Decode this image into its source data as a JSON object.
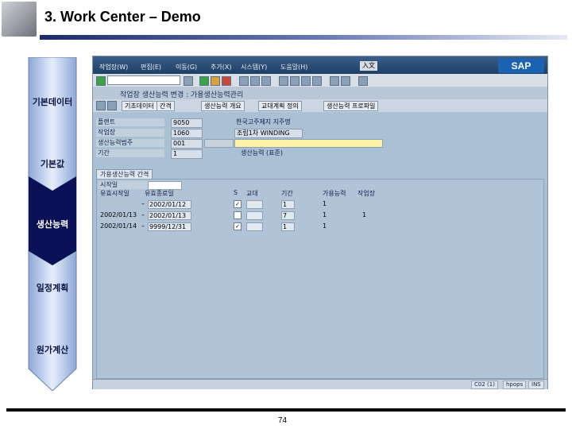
{
  "slide": {
    "title": "3. Work Center – Demo",
    "page_number": "74"
  },
  "flow_steps": [
    {
      "label": "기본데이터",
      "active": false
    },
    {
      "label": "기본값",
      "active": false
    },
    {
      "label": "생산능력",
      "active": true
    },
    {
      "label": "일정계획",
      "active": false
    },
    {
      "label": "원가계산",
      "active": false
    }
  ],
  "sap": {
    "menu": [
      "작업장(W)",
      "편집(E)",
      "이동(G)",
      "추가(X)",
      "시스템(Y)",
      "도움말(H)"
    ],
    "lang_badge": "入文",
    "logo": "SAP",
    "title": "작업장 생산능력 변경 : 가용생산능력관리",
    "app_buttons": [
      "기초데이터",
      "간격",
      "생산능력 개요",
      "교대계획 정의",
      "생산능력 프로파일"
    ],
    "fields": [
      {
        "label": "플랜트",
        "value": "9050",
        "desc": "한국고주제지 지주명"
      },
      {
        "label": "작업장",
        "value": "1060",
        "desc": "조립1차 WINDING"
      },
      {
        "label": "생산능력범주",
        "value": "001",
        "desc": ""
      },
      {
        "label": "기간",
        "value": "1",
        "desc": "생산능력 (표준)"
      }
    ],
    "tab": "가용생산능력 간격",
    "panel_label": "시작일",
    "columns": [
      "유효시작일",
      "유효종료일",
      "S",
      "교대",
      "기간",
      "가용능력",
      "작업장"
    ],
    "rows": [
      {
        "from": "",
        "to": "2002/01/12",
        "check": "✓",
        "shift": "",
        "period": "1",
        "cap": "1",
        "wc": ""
      },
      {
        "from": "2002/01/13",
        "to": "2002/01/13",
        "check": "",
        "shift": "",
        "period": "7",
        "cap": "1",
        "wc": "1"
      },
      {
        "from": "2002/01/14",
        "to": "9999/12/31",
        "check": "✓",
        "shift": "",
        "period": "1",
        "cap": "1",
        "wc": ""
      }
    ],
    "status": [
      "C02 (1)",
      "hpops",
      "INS"
    ]
  }
}
